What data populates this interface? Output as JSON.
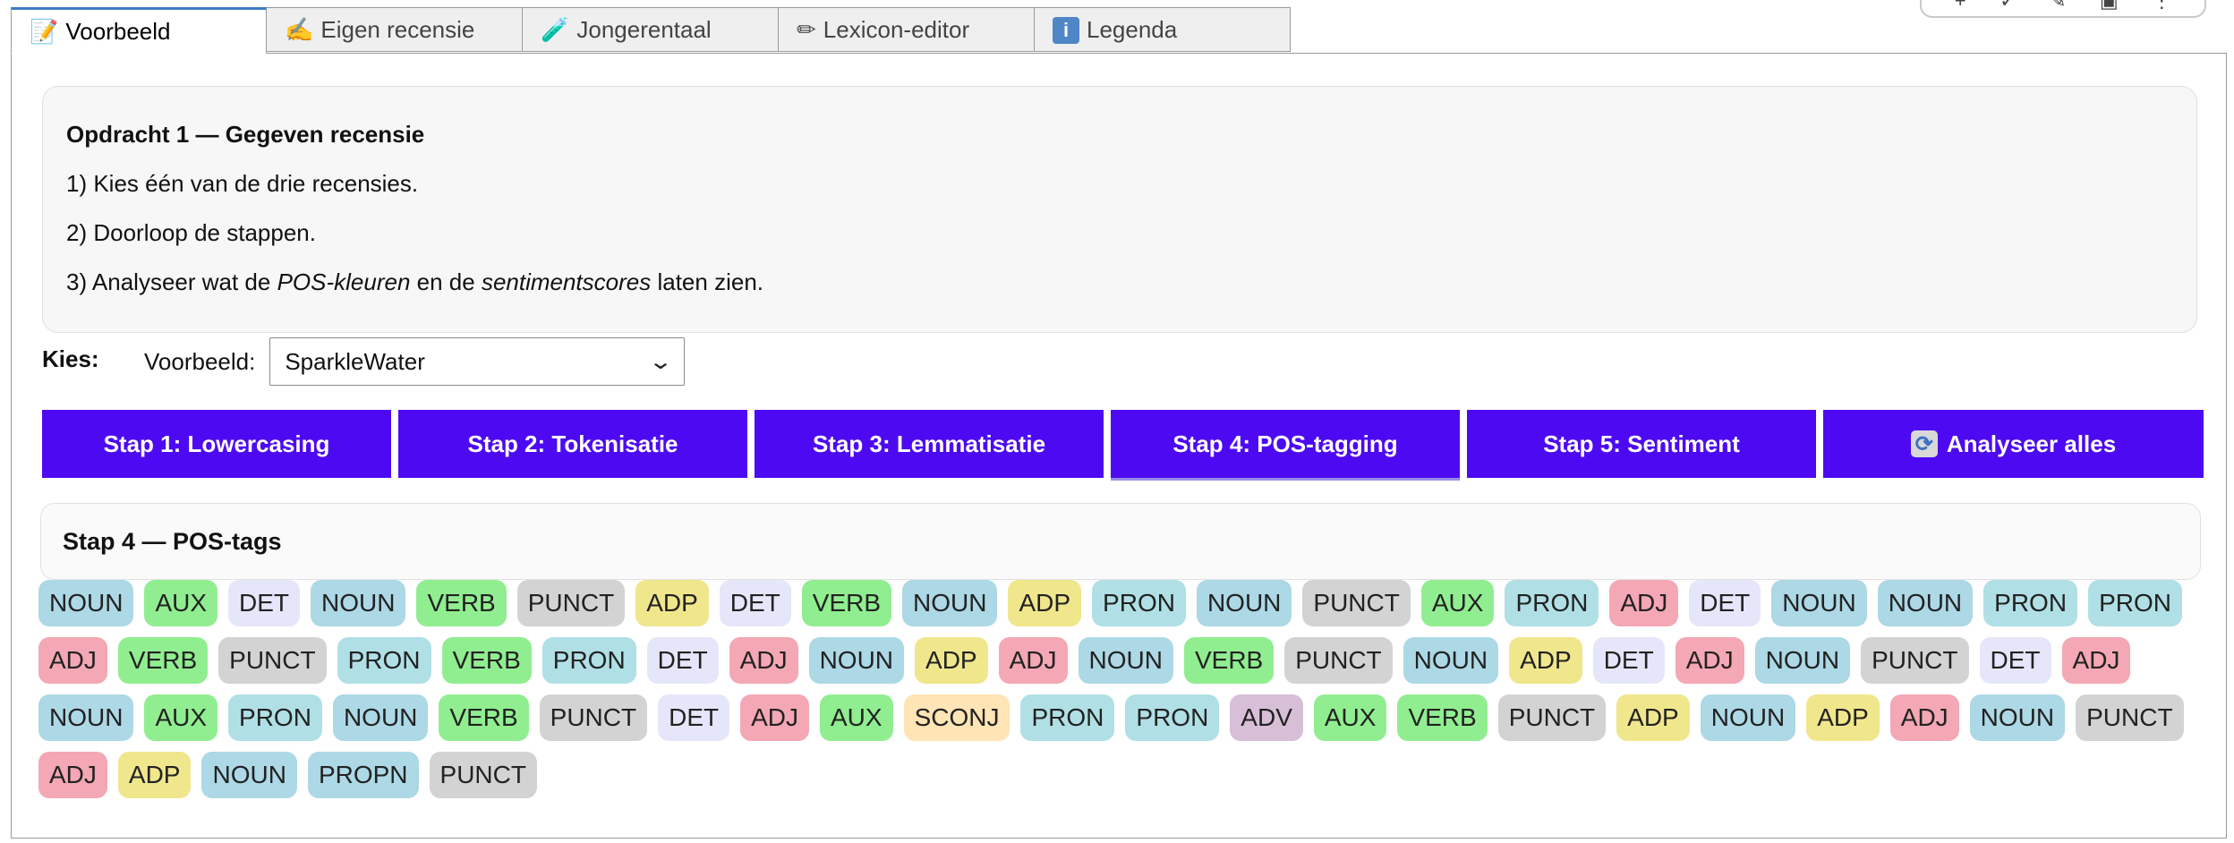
{
  "toolbar": {
    "items": [
      {
        "name": "plus-icon",
        "glyph": "+"
      },
      {
        "name": "check-icon",
        "glyph": "✓"
      },
      {
        "name": "edit-icon",
        "glyph": "✎"
      },
      {
        "name": "save-icon",
        "glyph": "▣"
      },
      {
        "name": "more-icon",
        "glyph": "⋮"
      }
    ]
  },
  "tabs": [
    {
      "label": "Voorbeeld",
      "icon": "memo-icon",
      "glyph": "📝",
      "active": true
    },
    {
      "label": "Eigen recensie",
      "icon": "writing-hand-icon",
      "glyph": "✍",
      "active": false
    },
    {
      "label": "Jongerentaal",
      "icon": "test-tube-icon",
      "glyph": "🧪",
      "active": false
    },
    {
      "label": "Lexicon-editor",
      "icon": "pencil-icon",
      "glyph": "✏",
      "active": false
    },
    {
      "label": "Legenda",
      "icon": "info-icon",
      "glyph": "i",
      "active": false
    }
  ],
  "opdracht": {
    "title": "Opdracht 1 — Gegeven recensie",
    "line1": "1) Kies één van de drie recensies.",
    "line2": "2) Doorloop de stappen.",
    "line3_a": "3) Analyseer wat de ",
    "line3_b": "POS-kleuren",
    "line3_c": " en de ",
    "line3_d": "sentimentscores",
    "line3_e": " laten zien."
  },
  "kies": {
    "label": "Kies:",
    "voorbeeld_label": "Voorbeeld:",
    "selected": "SparkleWater"
  },
  "steps": [
    {
      "label": "Stap 1: Lowercasing",
      "active": false
    },
    {
      "label": "Stap 2: Tokenisatie",
      "active": false
    },
    {
      "label": "Stap 3: Lemmatisatie",
      "active": false
    },
    {
      "label": "Stap 4: POS-tagging",
      "active": true
    },
    {
      "label": "Stap 5: Sentiment",
      "active": false
    }
  ],
  "analyse_all": {
    "label": "Analyseer alles",
    "icon": "sync-icon",
    "glyph": "🔄"
  },
  "stap4": {
    "title": "Stap 4 — POS-tags"
  },
  "tag_colors": {
    "NOUN": "#add8e6",
    "AUX": "#90ee90",
    "VERB": "#90ee90",
    "DET": "#e6e6fa",
    "PUNCT": "#d3d3d3",
    "ADP": "#f0e68c",
    "PRON": "#b0e0e6",
    "ADJ": "#f4a7b4",
    "SCONJ": "#ffe4b5",
    "ADV": "#d8bfd8",
    "PROPN": "#add8e6"
  },
  "pos_tags": [
    "NOUN",
    "AUX",
    "DET",
    "NOUN",
    "VERB",
    "PUNCT",
    "ADP",
    "DET",
    "VERB",
    "NOUN",
    "ADP",
    "PRON",
    "NOUN",
    "PUNCT",
    "AUX",
    "PRON",
    "ADJ",
    "DET",
    "NOUN",
    "NOUN",
    "PRON",
    "PRON",
    "ADJ",
    "VERB",
    "PUNCT",
    "PRON",
    "VERB",
    "PRON",
    "DET",
    "ADJ",
    "NOUN",
    "ADP",
    "ADJ",
    "NOUN",
    "VERB",
    "PUNCT",
    "NOUN",
    "ADP",
    "DET",
    "ADJ",
    "NOUN",
    "PUNCT",
    "DET",
    "ADJ",
    "NOUN",
    "AUX",
    "PRON",
    "NOUN",
    "VERB",
    "PUNCT",
    "DET",
    "ADJ",
    "AUX",
    "SCONJ",
    "PRON",
    "PRON",
    "ADV",
    "AUX",
    "VERB",
    "PUNCT",
    "ADP",
    "NOUN",
    "ADP",
    "ADJ",
    "NOUN",
    "PUNCT",
    "ADJ",
    "ADP",
    "NOUN",
    "PROPN",
    "PUNCT"
  ]
}
